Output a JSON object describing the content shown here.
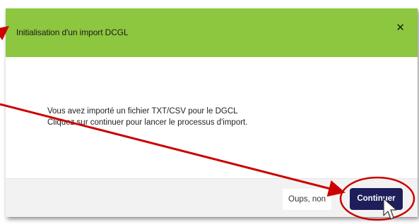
{
  "modal": {
    "title": "Initialisation d'un import DCGL",
    "close_icon": "close-icon",
    "body": {
      "line1": "Vous avez importé un fichier TXT/CSV pour le DGCL",
      "line2": "Cliquez sur continuer pour lancer le processus d'import."
    },
    "footer": {
      "cancel_label": "Oups, non",
      "continue_label": "Continuer"
    }
  },
  "colors": {
    "header": "#8dc63f",
    "primary_button": "#1e1e5a",
    "annotation": "#cc0000"
  },
  "annotations": {
    "arrows": [
      "arrow-to-title",
      "arrow-to-continue-button"
    ],
    "highlight": "highlight-circle-continue-button",
    "cursor": "mouse-pointer-icon"
  }
}
